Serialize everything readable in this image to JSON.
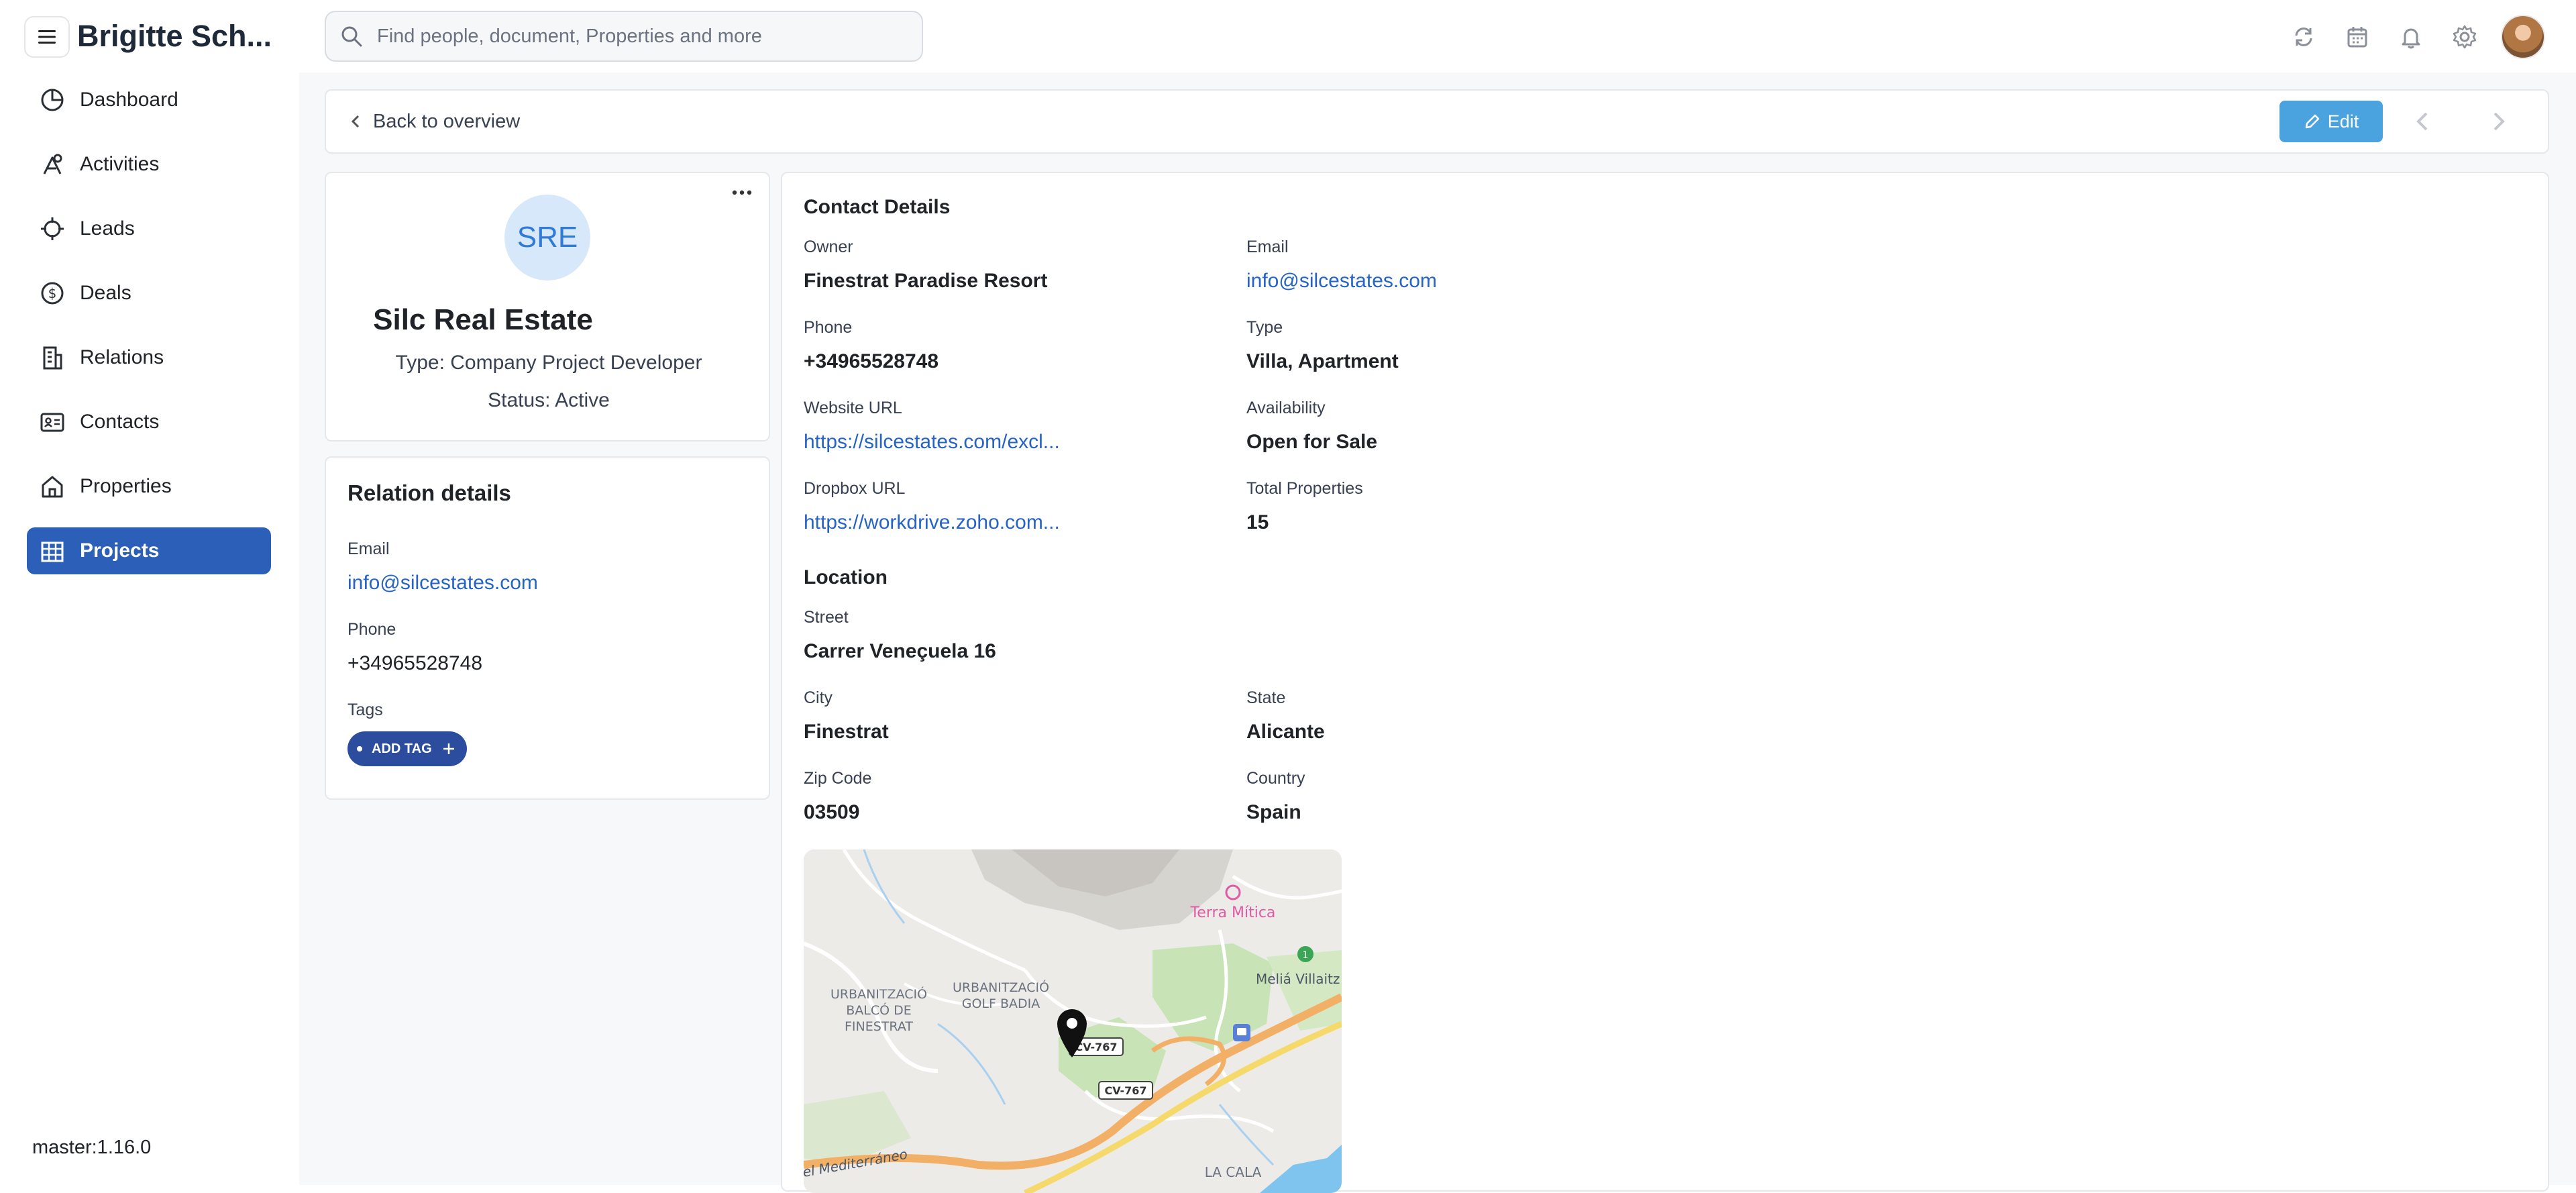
{
  "app": {
    "user_name": "Brigitte Sch...",
    "version": "master:1.16.0"
  },
  "colors": {
    "accent": "#2b5fb8",
    "edit_button": "#4aa3df",
    "link": "#2563c4",
    "tag": "#2c4d9d"
  },
  "sidebar": {
    "items": [
      {
        "label": "Dashboard",
        "icon": "dashboard-icon"
      },
      {
        "label": "Activities",
        "icon": "activities-icon"
      },
      {
        "label": "Leads",
        "icon": "leads-icon"
      },
      {
        "label": "Deals",
        "icon": "deals-icon"
      },
      {
        "label": "Relations",
        "icon": "relations-icon"
      },
      {
        "label": "Contacts",
        "icon": "contacts-icon"
      },
      {
        "label": "Properties",
        "icon": "properties-icon"
      },
      {
        "label": "Projects",
        "icon": "projects-icon",
        "active": true
      }
    ]
  },
  "search": {
    "placeholder": "Find people, document, Properties and more"
  },
  "toolbar": {
    "back_label": "Back to overview",
    "edit_label": "Edit"
  },
  "profile": {
    "initials": "SRE",
    "name": "Silc Real Estate",
    "type_line": "Type: Company Project Developer",
    "status_line": "Status: Active"
  },
  "relation": {
    "title": "Relation details",
    "email_label": "Email",
    "email": "info@silcestates.com",
    "phone_label": "Phone",
    "phone": "+34965528748",
    "tags_label": "Tags",
    "add_tag_label": "ADD TAG"
  },
  "contact_details": {
    "title": "Contact Details",
    "owner_label": "Owner",
    "owner": "Finestrat Paradise Resort",
    "email_label": "Email",
    "email": "info@silcestates.com",
    "phone_label": "Phone",
    "phone": "+34965528748",
    "type_label": "Type",
    "type": "Villa, Apartment",
    "website_label": "Website URL",
    "website": "https://silcestates.com/excl...",
    "availability_label": "Availability",
    "availability": "Open for Sale",
    "dropbox_label": "Dropbox URL",
    "dropbox": "https://workdrive.zoho.com...",
    "total_label": "Total Properties",
    "total": "15"
  },
  "location": {
    "title": "Location",
    "street_label": "Street",
    "street": "Carrer Veneçuela 16",
    "city_label": "City",
    "city": "Finestrat",
    "state_label": "State",
    "state": "Alicante",
    "zip_label": "Zip Code",
    "zip": "03509",
    "country_label": "Country",
    "country": "Spain"
  },
  "map": {
    "labels": {
      "poi": "Terra Mítica",
      "area1_l1": "URBANITZACIÓ",
      "area1_l2": "BALCÓ DE",
      "area1_l3": "FINESTRAT",
      "area2_l1": "URBANITZACIÓ",
      "area2_l2": "GOLF BADIA",
      "hotel": "Meliá Villaitz",
      "road1": "CV-767",
      "road2": "CV-767",
      "sea": "el Mediterráneo",
      "town": "LA CALA"
    }
  }
}
